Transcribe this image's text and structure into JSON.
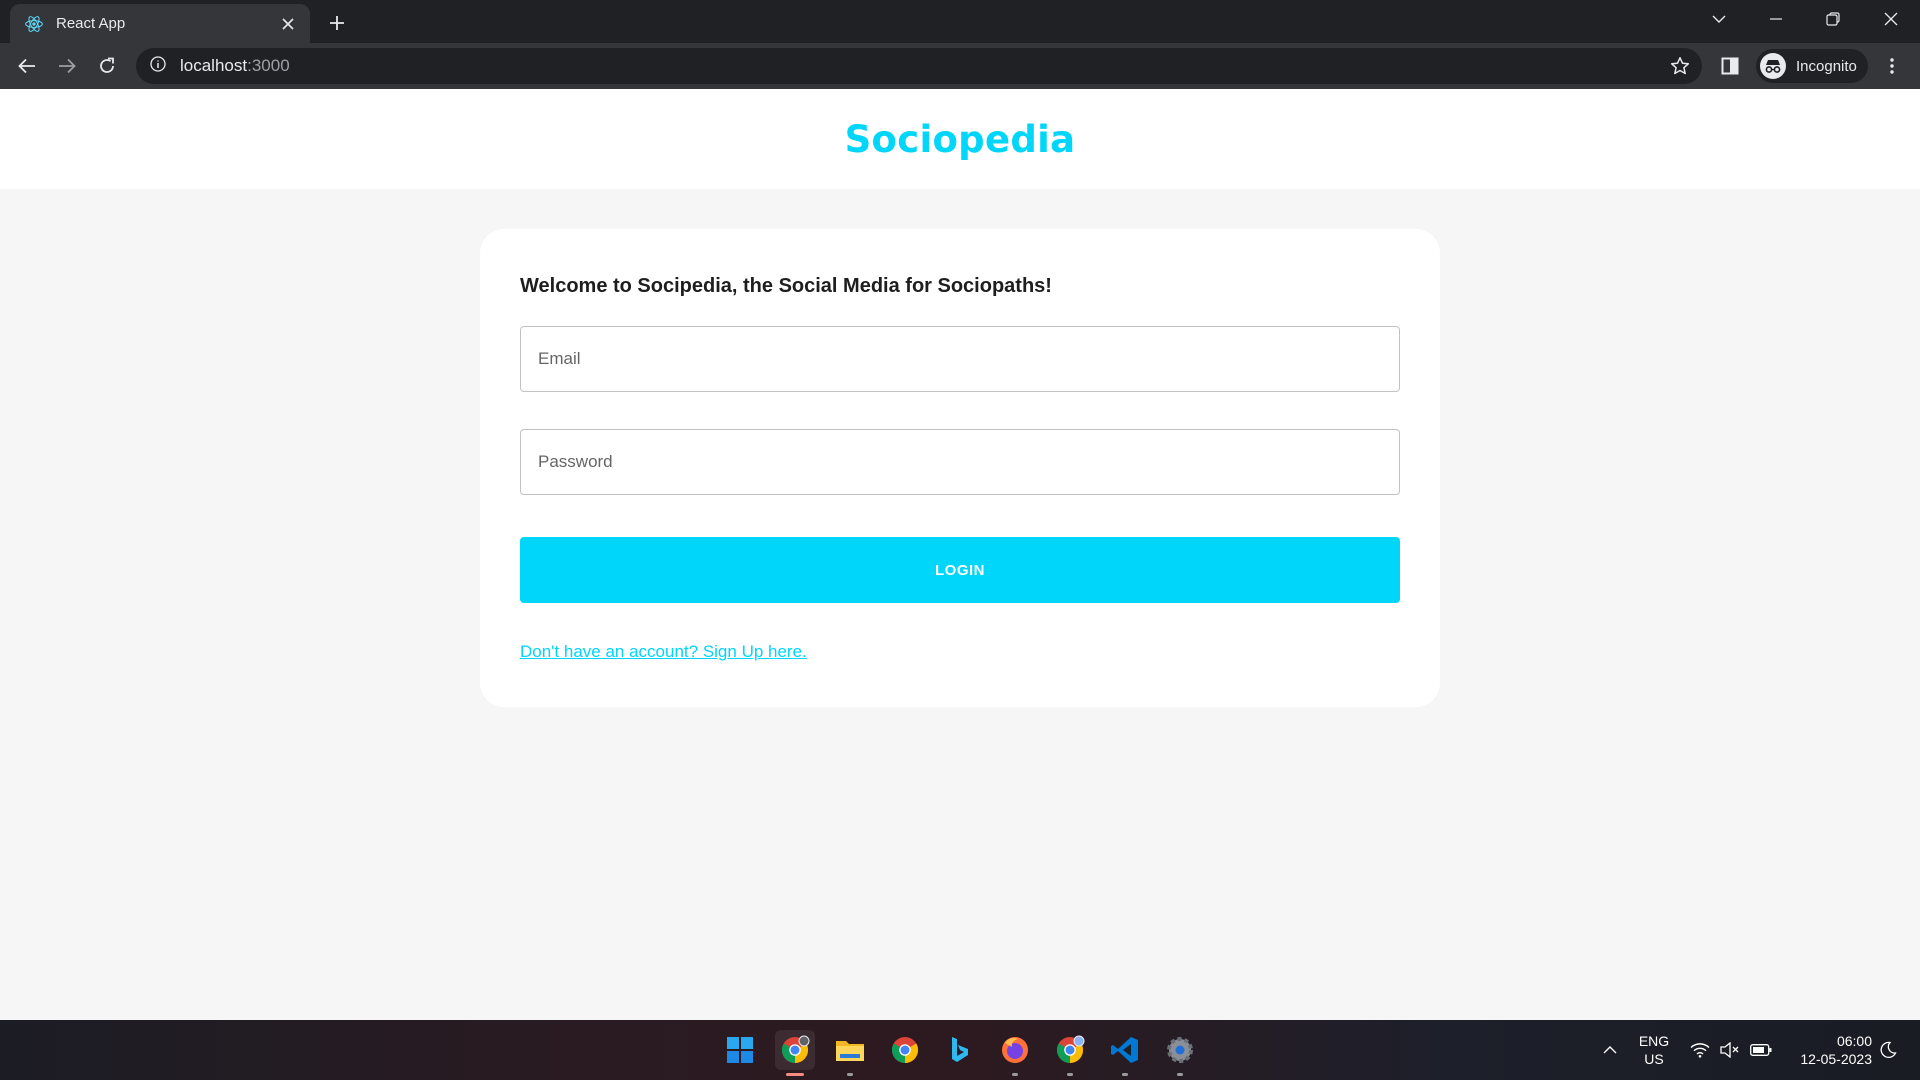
{
  "browser": {
    "tab_title": "React App",
    "url_host": "localhost",
    "url_port": ":3000",
    "profile_label": "Incognito"
  },
  "app": {
    "brand": "Sociopedia",
    "welcome": "Welcome to Socipedia, the Social Media for Sociopaths!",
    "email_placeholder": "Email",
    "password_placeholder": "Password",
    "login_label": "LOGIN",
    "signup_link": "Don't have an account? Sign Up here.",
    "brand_color": "#00d5fa"
  },
  "taskbar": {
    "language": "ENG",
    "region": "US",
    "time": "06:00",
    "date": "12-05-2023",
    "apps": [
      "windows-start-icon",
      "chrome-incognito-icon",
      "file-explorer-icon",
      "chrome-icon",
      "bing-icon",
      "firefox-icon",
      "chrome-profile-icon",
      "vscode-icon",
      "settings-icon"
    ]
  }
}
